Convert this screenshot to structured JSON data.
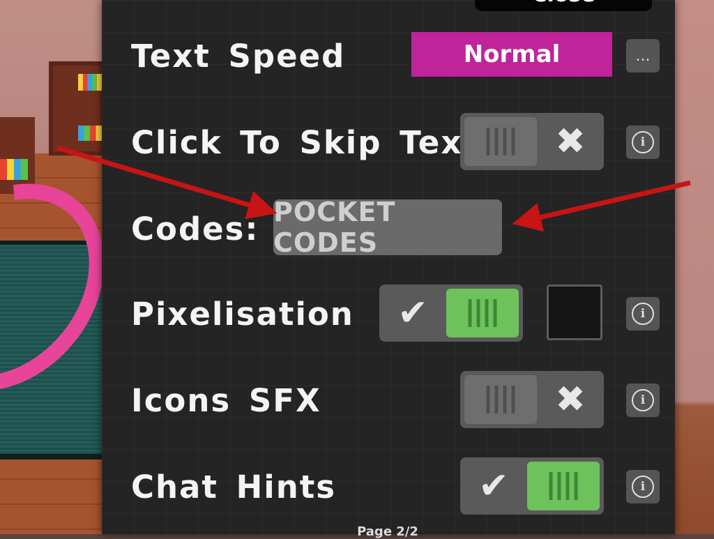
{
  "close_button": {
    "label": "Close"
  },
  "settings": {
    "text_speed": {
      "label": "Text Speed",
      "value": "Normal",
      "more_label": "..."
    },
    "click_to_skip": {
      "label": "Click To Skip Text",
      "state": "off",
      "mark": "✖"
    },
    "codes": {
      "label": "Codes:",
      "button_label": "POCKET CODES"
    },
    "pixelisation": {
      "label": "Pixelisation",
      "state": "on",
      "mark": "✔"
    },
    "icons_sfx": {
      "label": "Icons SFX",
      "state": "off",
      "mark": "✖"
    },
    "chat_hints": {
      "label": "Chat Hints",
      "state": "on",
      "mark": "✔"
    }
  },
  "info_glyph": "i",
  "page_indicator": "Page 2/2",
  "colors": {
    "accent_magenta": "#c0249a",
    "toggle_on": "#6ec25c",
    "toggle_off": "#6e6e6e",
    "panel_bg": "#242424",
    "arrow_red": "#c81414"
  }
}
